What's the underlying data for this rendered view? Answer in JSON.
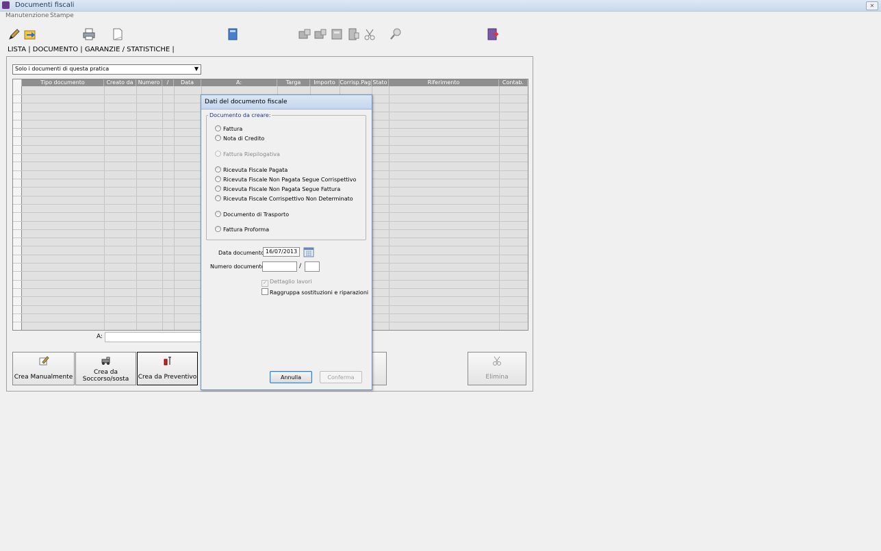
{
  "window": {
    "title": "Documenti fiscali"
  },
  "menu": [
    "Manutenzione",
    "Stampe"
  ],
  "toolbar": {
    "icons": [
      "pencil-icon",
      "folder-arrow-icon",
      "printer-icon",
      "page-icon",
      "book-icon",
      "transfer-1-icon",
      "transfer-2-icon",
      "transfer-3-icon",
      "transfer-4-icon",
      "scissors-icon",
      "search-icon",
      "exit-door-icon"
    ]
  },
  "tabs": {
    "lista": "LISTA",
    "documento": "DOCUMENTO",
    "garanzie": "GARANZIE / STATISTICHE"
  },
  "filter": {
    "value": "Solo i documenti di questa pratica"
  },
  "grid": {
    "columns": [
      "Tipo documento",
      "Creato da",
      "Numero",
      "/",
      "Data",
      "A:",
      "Targa",
      "Importo",
      "Corrisp.Pag",
      "Stato",
      "Riferimento",
      "Contab."
    ],
    "rows": []
  },
  "a_field": {
    "label": "A:",
    "value": ""
  },
  "buttons": {
    "crea_manualmente": "Crea Manualmente",
    "crea_da_soccorso_1": "Crea da",
    "crea_da_soccorso_2": "Soccorso/sosta",
    "crea_da_preventivo": "Crea da Preventivo",
    "elimina": "Elimina"
  },
  "dialog": {
    "title": "Dati del documento fiscale",
    "group_label": "Documento da creare:",
    "options": [
      {
        "label": "Fattura",
        "enabled": true
      },
      {
        "label": "Nota di Credito",
        "enabled": true
      },
      {
        "label": "Fattura Riepilogativa",
        "enabled": false
      },
      {
        "label": "Ricevuta Fiscale Pagata",
        "enabled": true
      },
      {
        "label": "Ricevuta Fiscale Non Pagata Segue Corrispettivo",
        "enabled": true
      },
      {
        "label": "Ricevuta Fiscale Non Pagata Segue Fattura",
        "enabled": true
      },
      {
        "label": "Ricevuta Fiscale Corrispettivo Non Determinato",
        "enabled": true
      },
      {
        "label": "Documento di Trasporto",
        "enabled": true
      },
      {
        "label": "Fattura Proforma",
        "enabled": true
      }
    ],
    "data_label": "Data documento:",
    "data_value": "16/07/2013",
    "numero_label": "Numero documento:",
    "numero_value": "",
    "numero_sep": "/",
    "numero_suffix": "",
    "dettaglio_label": "Dettaglio lavori",
    "dettaglio_checked": true,
    "raggruppa_label": "Raggruppa sostituzioni e riparazioni",
    "raggruppa_checked": false,
    "annulla": "Annulla",
    "conferma": "Conferma"
  }
}
